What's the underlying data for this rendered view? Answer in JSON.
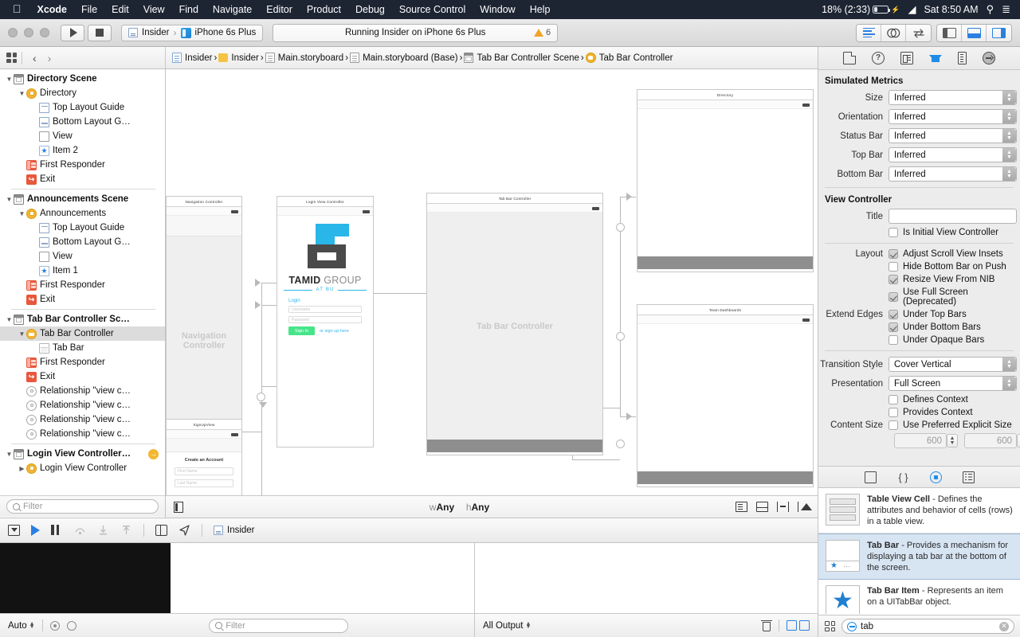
{
  "menubar": {
    "apple": "apple-logo",
    "items": [
      "Xcode",
      "File",
      "Edit",
      "View",
      "Find",
      "Navigate",
      "Editor",
      "Product",
      "Debug",
      "Source Control",
      "Window",
      "Help"
    ],
    "battery": "18% (2:33)",
    "clock": "Sat 8:50 AM"
  },
  "toolbar": {
    "scheme_project": "Insider",
    "scheme_sep": "›",
    "scheme_device": "iPhone 6s Plus",
    "activity": "Running Insider on iPhone 6s Plus",
    "warning_count": "6"
  },
  "jumpbar": {
    "crumbs": [
      {
        "label": "Insider",
        "icon": "project-icon"
      },
      {
        "label": "Insider",
        "icon": "folder-icon"
      },
      {
        "label": "Main.storyboard",
        "icon": "storyboard-file-icon"
      },
      {
        "label": "Main.storyboard (Base)",
        "icon": "storyboard-file-icon"
      },
      {
        "label": "Tab Bar Controller Scene",
        "icon": "scene-icon"
      },
      {
        "label": "Tab Bar Controller",
        "icon": "view-controller-icon"
      }
    ]
  },
  "navigator": {
    "filter_placeholder": "Filter",
    "tree": [
      {
        "label": "Directory Scene",
        "depth": 0,
        "icon": "scene",
        "twisty": "down",
        "scene": true
      },
      {
        "label": "Directory",
        "depth": 1,
        "icon": "vcirc",
        "twisty": "down"
      },
      {
        "label": "Top Layout Guide",
        "depth": 2,
        "icon": "tlg",
        "twisty": ""
      },
      {
        "label": "Bottom Layout G…",
        "depth": 2,
        "icon": "blg",
        "twisty": ""
      },
      {
        "label": "View",
        "depth": 2,
        "icon": "view",
        "twisty": ""
      },
      {
        "label": "Item 2",
        "depth": 2,
        "icon": "star",
        "twisty": ""
      },
      {
        "label": "First Responder",
        "depth": 1,
        "icon": "resp",
        "twisty": ""
      },
      {
        "label": "Exit",
        "depth": 1,
        "icon": "exit",
        "twisty": ""
      },
      {
        "divider": true
      },
      {
        "label": "Announcements Scene",
        "depth": 0,
        "icon": "scene",
        "twisty": "down",
        "scene": true
      },
      {
        "label": "Announcements",
        "depth": 1,
        "icon": "vcirc",
        "twisty": "down"
      },
      {
        "label": "Top Layout Guide",
        "depth": 2,
        "icon": "tlg",
        "twisty": ""
      },
      {
        "label": "Bottom Layout G…",
        "depth": 2,
        "icon": "blg",
        "twisty": ""
      },
      {
        "label": "View",
        "depth": 2,
        "icon": "view",
        "twisty": ""
      },
      {
        "label": "Item 1",
        "depth": 2,
        "icon": "star",
        "twisty": ""
      },
      {
        "label": "First Responder",
        "depth": 1,
        "icon": "resp",
        "twisty": ""
      },
      {
        "label": "Exit",
        "depth": 1,
        "icon": "exit",
        "twisty": ""
      },
      {
        "divider": true
      },
      {
        "label": "Tab Bar Controller Sc…",
        "depth": 0,
        "icon": "scene",
        "twisty": "down",
        "scene": true
      },
      {
        "label": "Tab Bar Controller",
        "depth": 1,
        "icon": "tabvc",
        "twisty": "down",
        "selected": true
      },
      {
        "label": "Tab Bar",
        "depth": 2,
        "icon": "tabbar",
        "twisty": ""
      },
      {
        "label": "First Responder",
        "depth": 1,
        "icon": "resp",
        "twisty": ""
      },
      {
        "label": "Exit",
        "depth": 1,
        "icon": "exit",
        "twisty": ""
      },
      {
        "label": "Relationship \"view c…",
        "depth": 1,
        "icon": "rel",
        "twisty": ""
      },
      {
        "label": "Relationship \"view c…",
        "depth": 1,
        "icon": "rel",
        "twisty": ""
      },
      {
        "label": "Relationship \"view c…",
        "depth": 1,
        "icon": "rel",
        "twisty": ""
      },
      {
        "label": "Relationship \"view c…",
        "depth": 1,
        "icon": "rel",
        "twisty": ""
      },
      {
        "divider": true
      },
      {
        "label": "Login View Controller…",
        "depth": 0,
        "icon": "scene",
        "twisty": "down",
        "scene": true,
        "badge": "→"
      },
      {
        "label": "Login View Controller",
        "depth": 1,
        "icon": "vcirc",
        "twisty": "right"
      }
    ]
  },
  "canvas": {
    "size_class_w": "wAny",
    "size_class_h": "hAny",
    "scenes": [
      {
        "name": "navigation-controller",
        "title": "Navigation Controller",
        "placeholder": "Navigation Controller"
      },
      {
        "name": "login-view-controller",
        "title": "Login View Controller"
      },
      {
        "name": "tab-bar-controller",
        "title": "Tab Bar Controller",
        "placeholder": "Tab Bar Controller"
      },
      {
        "name": "directory",
        "title": "Directory"
      },
      {
        "name": "team-dashboards",
        "title": "Team Dashboards"
      },
      {
        "name": "signup-view",
        "title": "SignUpView"
      }
    ],
    "login_scene": {
      "brand_bold": "TAMID",
      "brand_light": " GROUP",
      "subtitle": "AT BU",
      "form_label": "Login",
      "username_placeholder": "Username",
      "password_placeholder": "Password",
      "signin_label": "Sign In",
      "signup_link": "or sign up here",
      "accent_cyan": "#29b6e8",
      "accent_green": "#46e58a",
      "logo_gray": "#4a4a4a"
    },
    "signup_scene": {
      "title": "Create an Account",
      "first_name_placeholder": "First Name",
      "last_name_placeholder": "Last Name"
    }
  },
  "debug_bar": {
    "process_label": "Insider"
  },
  "debug_footer": {
    "auto_label": "Auto",
    "filter_placeholder": "Filter",
    "output_label": "All Output"
  },
  "inspector": {
    "simulated_metrics": {
      "title": "Simulated Metrics",
      "rows": [
        {
          "label": "Size",
          "value": "Inferred"
        },
        {
          "label": "Orientation",
          "value": "Inferred"
        },
        {
          "label": "Status Bar",
          "value": "Inferred"
        },
        {
          "label": "Top Bar",
          "value": "Inferred"
        },
        {
          "label": "Bottom Bar",
          "value": "Inferred"
        }
      ]
    },
    "view_controller": {
      "title": "View Controller",
      "title_label": "Title",
      "title_value": "",
      "is_initial_label": "Is Initial View Controller",
      "is_initial_checked": false,
      "layout_label": "Layout",
      "layout_items": [
        {
          "label": "Adjust Scroll View Insets",
          "checked": true
        },
        {
          "label": "Hide Bottom Bar on Push",
          "checked": false
        },
        {
          "label": "Resize View From NIB",
          "checked": true
        },
        {
          "label": "Use Full Screen (Deprecated)",
          "checked": true
        }
      ],
      "extend_edges_label": "Extend Edges",
      "extend_edges_items": [
        {
          "label": "Under Top Bars",
          "checked": true
        },
        {
          "label": "Under Bottom Bars",
          "checked": true
        },
        {
          "label": "Under Opaque Bars",
          "checked": false
        }
      ],
      "transition_style_label": "Transition Style",
      "transition_style_value": "Cover Vertical",
      "presentation_label": "Presentation",
      "presentation_value": "Full Screen",
      "defines_context_label": "Defines Context",
      "defines_context_checked": false,
      "provides_context_label": "Provides Context",
      "provides_context_checked": false,
      "content_size_label": "Content Size",
      "use_preferred_label": "Use Preferred Explicit Size",
      "use_preferred_checked": false,
      "width_value": "600",
      "height_value": "600"
    }
  },
  "library": {
    "search_value": "tab",
    "items": [
      {
        "name": "Table View Cell",
        "title": "Table View Cell",
        "description": " - Defines the attributes and behavior of cells (rows) in a table view.",
        "selected": false
      },
      {
        "name": "Tab Bar",
        "title": "Tab Bar",
        "description": " - Provides a mechanism for displaying a tab bar at the bottom of the screen.",
        "selected": true
      },
      {
        "name": "Tab Bar Item",
        "title": "Tab Bar Item",
        "description": " - Represents an item on a UITabBar object.",
        "selected": false
      }
    ]
  }
}
